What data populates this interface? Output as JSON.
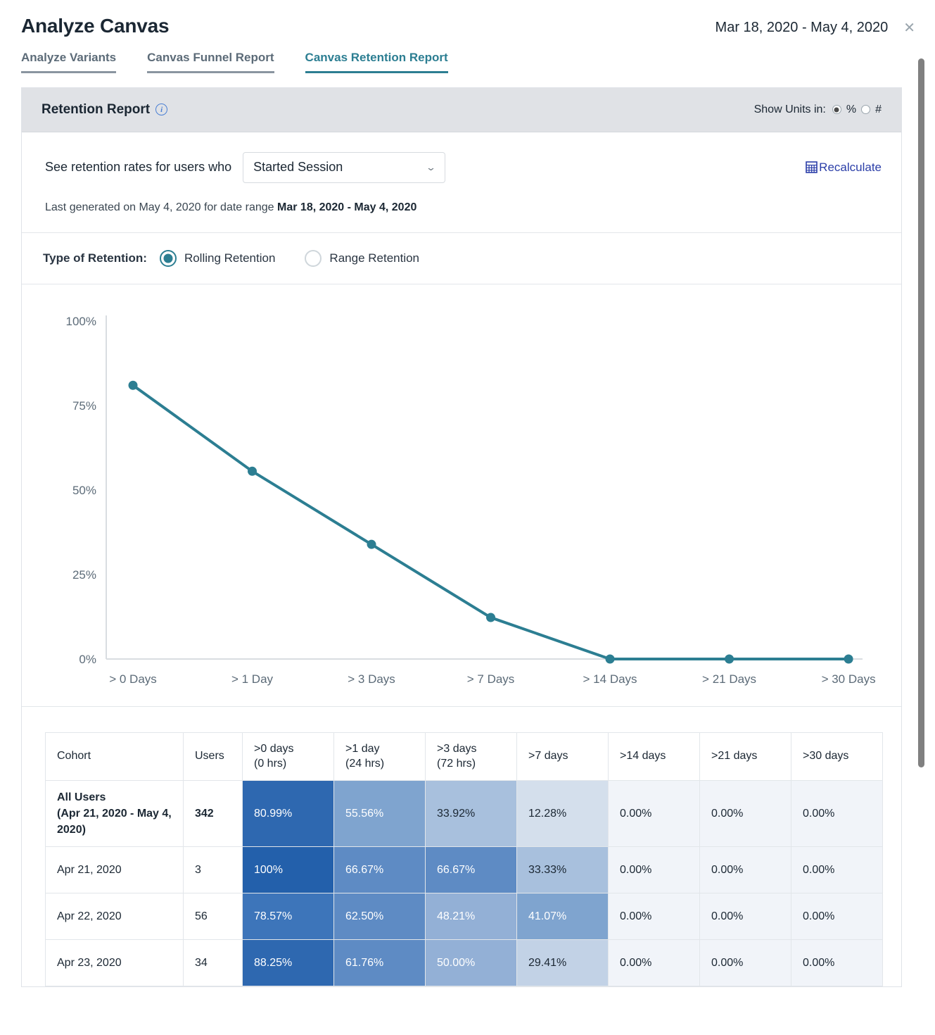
{
  "header": {
    "title": "Analyze Canvas",
    "date_range": "Mar 18, 2020 - May 4, 2020",
    "close_icon": "close-icon"
  },
  "tabs": [
    {
      "label": "Analyze Variants",
      "active": false
    },
    {
      "label": "Canvas Funnel Report",
      "active": false
    },
    {
      "label": "Canvas Retention Report",
      "active": true
    }
  ],
  "card": {
    "header_title": "Retention Report",
    "info_icon": "i",
    "units": {
      "label": "Show Units in:",
      "option_percent": "%",
      "option_count": "#",
      "selected": "%"
    },
    "filter": {
      "label": "See retention rates for users who",
      "select_value": "Started Session",
      "chevron": "chevron-down-icon",
      "recalculate_label": "Recalculate"
    },
    "last_generated": {
      "prefix": "Last generated on May 4, 2020 for date range ",
      "range": "Mar 18, 2020 - May 4, 2020"
    },
    "retention_type": {
      "label": "Type of Retention:",
      "options": [
        {
          "label": "Rolling Retention",
          "selected": true
        },
        {
          "label": "Range Retention",
          "selected": false
        }
      ]
    }
  },
  "chart_data": {
    "type": "line",
    "title": "",
    "xlabel": "",
    "ylabel": "",
    "categories": [
      "> 0 Days",
      "> 1 Day",
      "> 3 Days",
      "> 7 Days",
      "> 14 Days",
      "> 21 Days",
      "> 30 Days"
    ],
    "series": [
      {
        "name": "All Users",
        "values": [
          80.99,
          55.56,
          33.92,
          12.28,
          0.0,
          0.0,
          0.0
        ]
      }
    ],
    "ytick_labels": [
      "100%",
      "75%",
      "50%",
      "25%",
      "0%"
    ],
    "ytick_values": [
      100,
      75,
      50,
      25,
      0
    ],
    "ylim": [
      0,
      100
    ],
    "grid": false,
    "legend": "none",
    "line_color": "#2c7e92",
    "marker_color": "#2c7e92"
  },
  "table": {
    "columns": [
      {
        "line1": "Cohort",
        "line2": ""
      },
      {
        "line1": "Users",
        "line2": ""
      },
      {
        "line1": ">0 days",
        "line2": "(0 hrs)"
      },
      {
        "line1": ">1 day",
        "line2": "(24 hrs)"
      },
      {
        "line1": ">3 days",
        "line2": "(72 hrs)"
      },
      {
        "line1": ">7 days",
        "line2": ""
      },
      {
        "line1": ">14 days",
        "line2": ""
      },
      {
        "line1": ">21 days",
        "line2": ""
      },
      {
        "line1": ">30 days",
        "line2": ""
      }
    ],
    "rows": [
      {
        "cohort": "All Users\n(Apr 21, 2020 - May 4, 2020)",
        "users": "342",
        "values": [
          "80.99%",
          "55.56%",
          "33.92%",
          "12.28%",
          "0.00%",
          "0.00%",
          "0.00%"
        ],
        "cell_colors": [
          "#2e68b0",
          "#7fa4cf",
          "#a8c0dd",
          "#d4dfec",
          "#f1f4f9",
          "#f1f4f9",
          "#f1f4f9"
        ],
        "text_colors": [
          "#ffffff",
          "#ffffff",
          "#1b2733",
          "#1b2733",
          "#1b2733",
          "#1b2733",
          "#1b2733"
        ],
        "is_all_users": true
      },
      {
        "cohort": "Apr 21, 2020",
        "users": "3",
        "values": [
          "100%",
          "66.67%",
          "66.67%",
          "33.33%",
          "0.00%",
          "0.00%",
          "0.00%"
        ],
        "cell_colors": [
          "#2360ab",
          "#5e8bc4",
          "#5e8bc4",
          "#a8c0dd",
          "#f1f4f9",
          "#f1f4f9",
          "#f1f4f9"
        ],
        "text_colors": [
          "#ffffff",
          "#ffffff",
          "#ffffff",
          "#1b2733",
          "#1b2733",
          "#1b2733",
          "#1b2733"
        ],
        "is_all_users": false
      },
      {
        "cohort": "Apr 22, 2020",
        "users": "56",
        "values": [
          "78.57%",
          "62.50%",
          "48.21%",
          "41.07%",
          "0.00%",
          "0.00%",
          "0.00%"
        ],
        "cell_colors": [
          "#3d75ba",
          "#5e8bc4",
          "#93b0d6",
          "#7fa4cf",
          "#f1f4f9",
          "#f1f4f9",
          "#f1f4f9"
        ],
        "text_colors": [
          "#ffffff",
          "#ffffff",
          "#ffffff",
          "#ffffff",
          "#1b2733",
          "#1b2733",
          "#1b2733"
        ],
        "is_all_users": false
      },
      {
        "cohort": "Apr 23, 2020",
        "users": "34",
        "values": [
          "88.25%",
          "61.76%",
          "50.00%",
          "29.41%",
          "0.00%",
          "0.00%",
          "0.00%"
        ],
        "cell_colors": [
          "#2e68b0",
          "#5e8bc4",
          "#93b0d6",
          "#c2d2e6",
          "#f1f4f9",
          "#f1f4f9",
          "#f1f4f9"
        ],
        "text_colors": [
          "#ffffff",
          "#ffffff",
          "#ffffff",
          "#1b2733",
          "#1b2733",
          "#1b2733",
          "#1b2733"
        ],
        "is_all_users": false
      }
    ]
  },
  "scrollbar": {
    "present": true
  }
}
